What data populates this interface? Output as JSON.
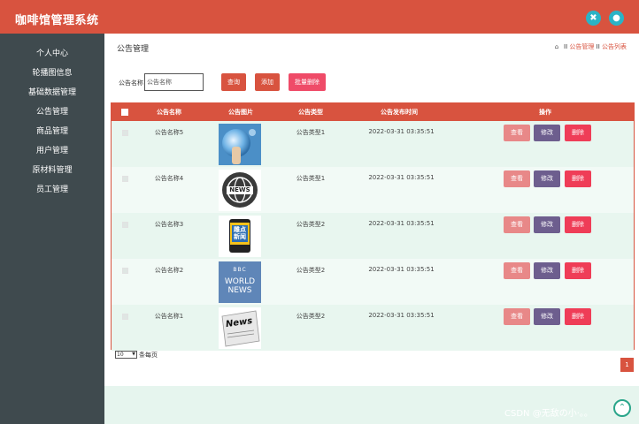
{
  "app": {
    "title": "咖啡馆管理系统"
  },
  "header": {
    "icons": [
      "tools-icon",
      "user-icon"
    ]
  },
  "sidebar": {
    "items": [
      {
        "label": "个人中心"
      },
      {
        "label": "轮播图信息"
      },
      {
        "label": "基础数据管理"
      },
      {
        "label": "公告管理"
      },
      {
        "label": "商品管理"
      },
      {
        "label": "用户管理"
      },
      {
        "label": "原材料管理"
      },
      {
        "label": "员工管理"
      }
    ]
  },
  "page": {
    "title": "公告管理",
    "breadcrumb": {
      "separator": "II",
      "items": [
        "公告管理",
        "公告列表"
      ]
    }
  },
  "search": {
    "label": "公告名称",
    "placeholder": "公告名称",
    "query_button": "查询",
    "add_button": "添加",
    "batch_delete_button": "批量删除"
  },
  "table": {
    "columns": [
      "公告名称",
      "公告图片",
      "公告类型",
      "公告发布时间",
      "操作"
    ],
    "rows": [
      {
        "name": "公告名称5",
        "image": "sphere",
        "type": "公告类型1",
        "time": "2022-03-31 03:35:51"
      },
      {
        "name": "公告名称4",
        "image": "news-globe",
        "type": "公告类型1",
        "time": "2022-03-31 03:35:51"
      },
      {
        "name": "公告名称3",
        "image": "hot-news",
        "type": "公告类型2",
        "time": "2022-03-31 03:35:51"
      },
      {
        "name": "公告名称2",
        "image": "bbc-world-news",
        "type": "公告类型2",
        "time": "2022-03-31 03:35:51"
      },
      {
        "name": "公告名称1",
        "image": "newspaper",
        "type": "公告类型2",
        "time": "2022-03-31 03:35:51"
      }
    ],
    "actions": {
      "view": "查看",
      "edit": "修改",
      "delete": "删除"
    },
    "thumb_text": {
      "news_globe": "NEWS",
      "hot_news_line1": "雕点",
      "hot_news_line2": "新闻",
      "bbc_logo": "BBC",
      "bbc_line1": "WORLD",
      "bbc_line2": "NEWS",
      "newspaper": "News"
    }
  },
  "pagination": {
    "page_size": "10",
    "page_size_suffix": "条每页",
    "current_page": "1"
  },
  "footer": {
    "watermark": "CSDN @无敌の小·。。"
  },
  "colors": {
    "primary": "#d8533f",
    "sidebar": "#3f4a4e",
    "accent": "#2bb3c6",
    "edit": "#6d5e8e",
    "delete": "#ef3d57",
    "view": "#e88888"
  }
}
